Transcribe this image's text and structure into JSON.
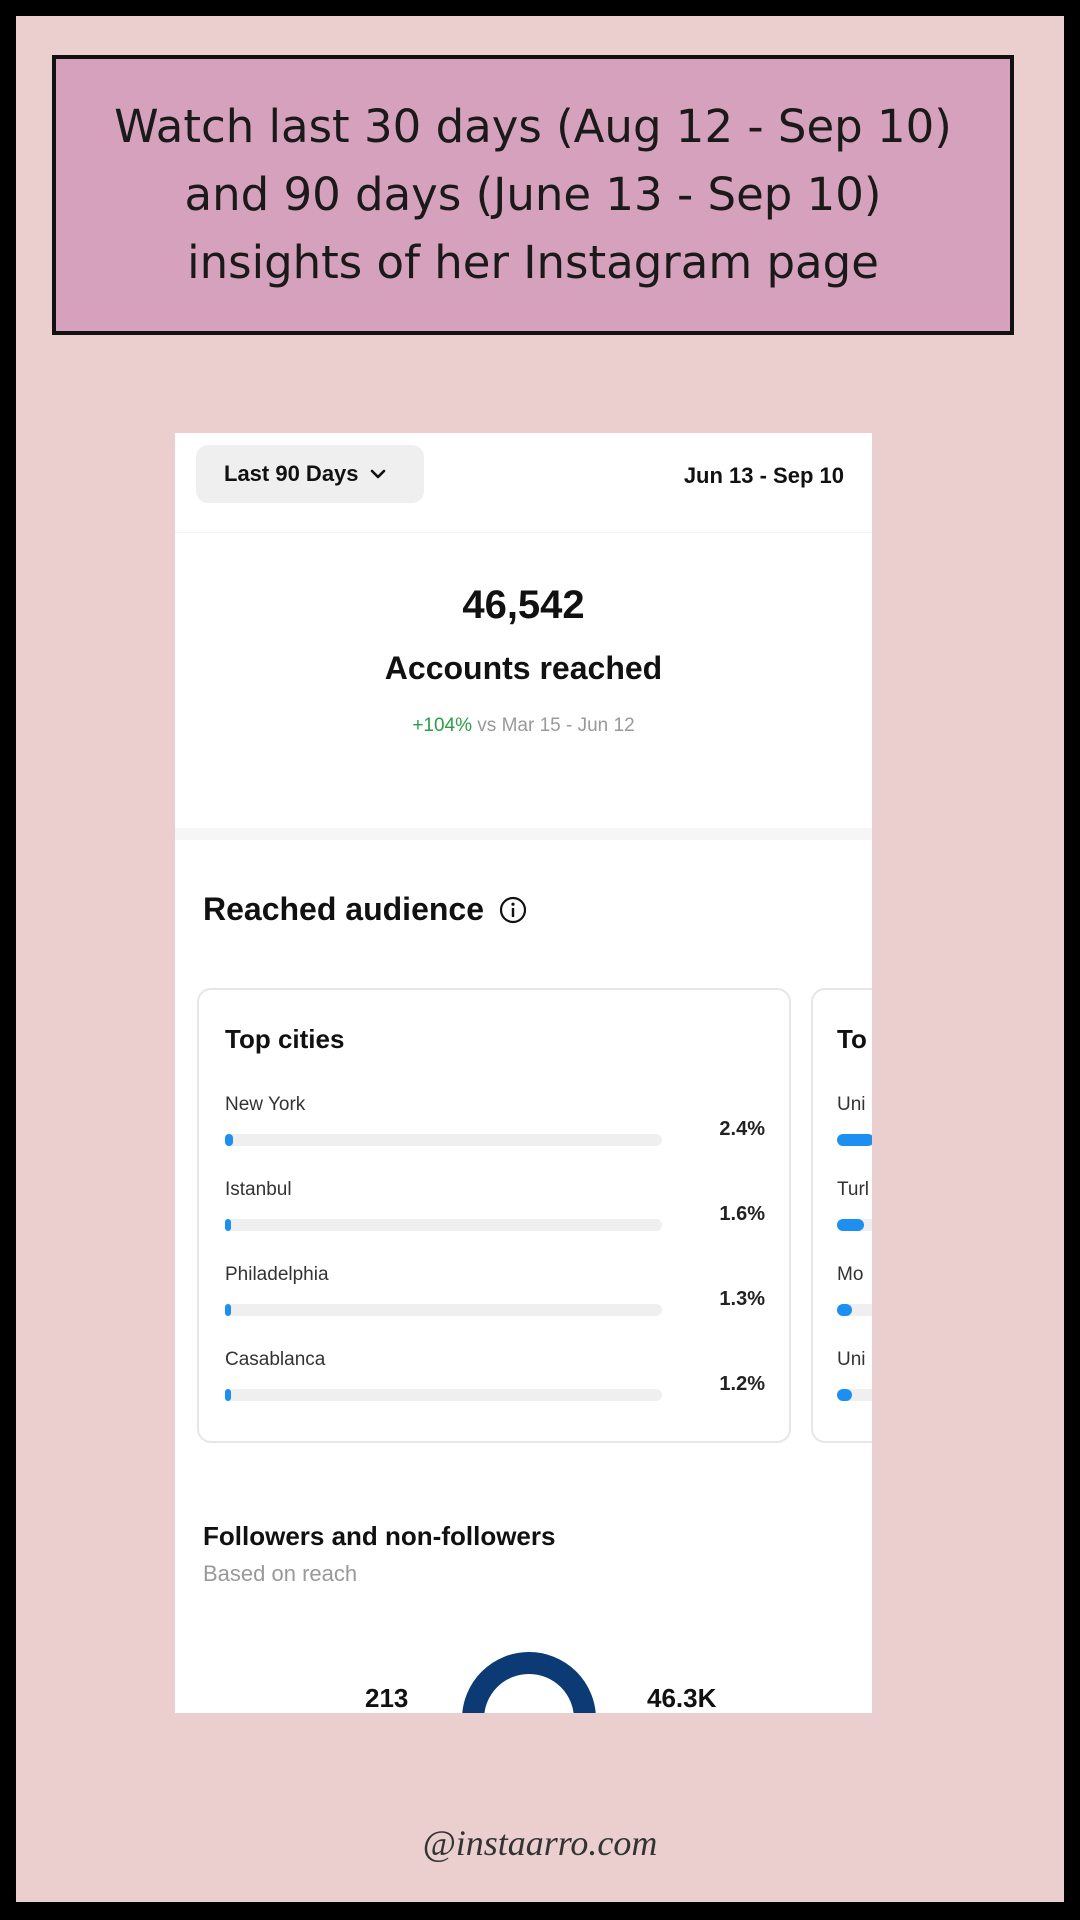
{
  "banner": {
    "text": "Watch last 30 days (Aug 12 - Sep 10) and 90 days  (June 13 - Sep 10) insights of her Instagram page"
  },
  "header": {
    "range_label": "Last 90 Days",
    "date_range": "Jun 13 - Sep 10"
  },
  "reach": {
    "value": "46,542",
    "label": "Accounts reached",
    "delta_pct": "+104%",
    "delta_text": " vs Mar 15 - Jun 12"
  },
  "audience": {
    "title": "Reached audience",
    "top_cities": {
      "title": "Top cities",
      "items": [
        {
          "label": "New York",
          "value": "2.4%",
          "fraction": 0.024
        },
        {
          "label": "Istanbul",
          "value": "1.6%",
          "fraction": 0.016
        },
        {
          "label": "Philadelphia",
          "value": "1.3%",
          "fraction": 0.013
        },
        {
          "label": "Casablanca",
          "value": "1.2%",
          "fraction": 0.012
        }
      ]
    },
    "top_countries": {
      "title": "To",
      "items": [
        {
          "label": "Uni",
          "fraction": 0.14
        },
        {
          "label": "Turl",
          "fraction": 0.1
        },
        {
          "label": "Mo",
          "fraction": 0.05
        },
        {
          "label": "Uni",
          "fraction": 0.05
        }
      ]
    }
  },
  "followers": {
    "title": "Followers and non-followers",
    "subtitle": "Based on reach",
    "followers_value": "213",
    "non_followers_value": "46.3K"
  },
  "watermark": "@instaarro.com",
  "colors": {
    "bar_fill": "#1c8ff0",
    "positive": "#2c9e45",
    "donut": "#0b3a74"
  }
}
